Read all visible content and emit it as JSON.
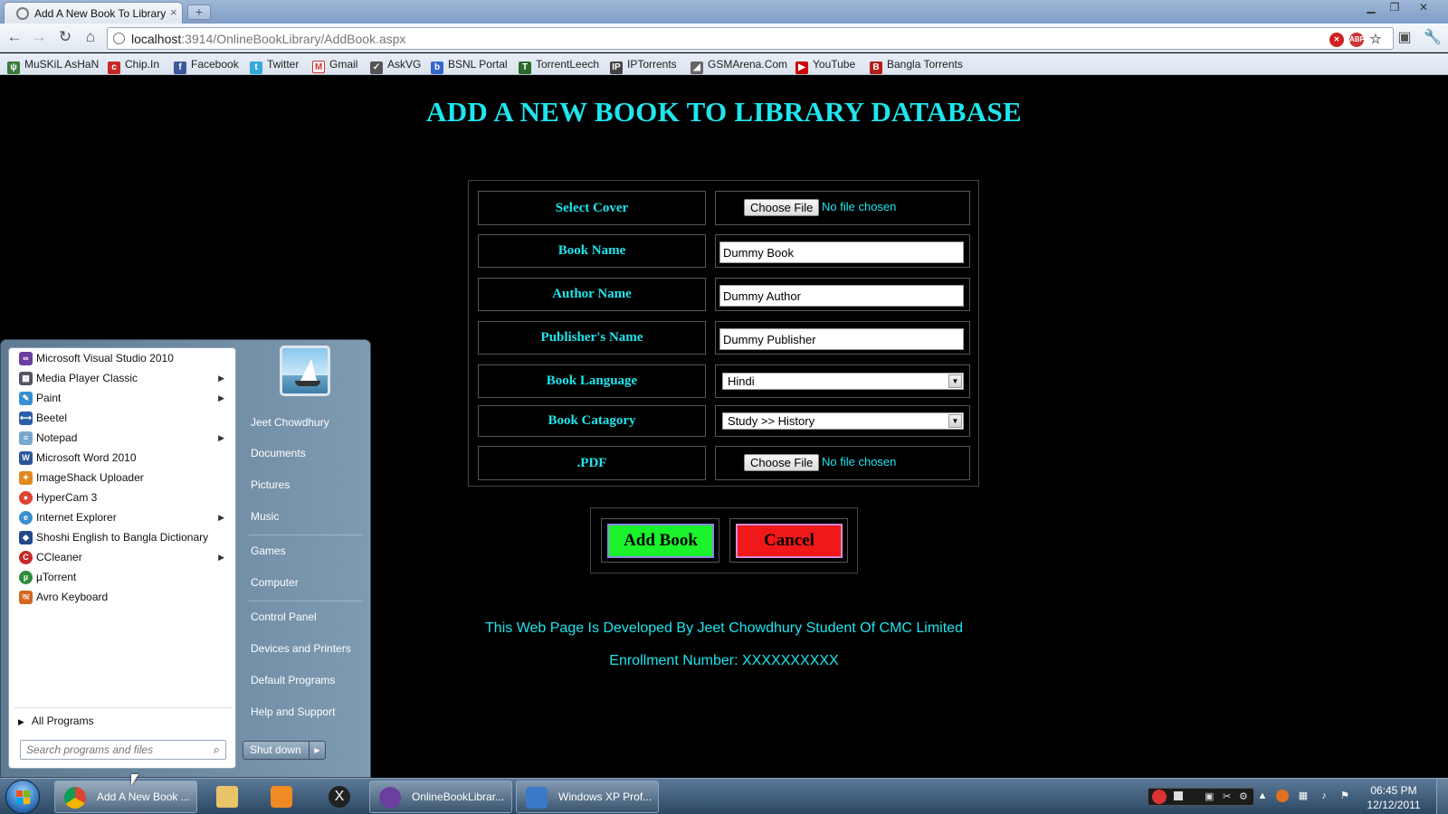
{
  "browser": {
    "tab_title": "Add A New Book To Library",
    "url_host": "localhost",
    "url_rest": ":3914/OnlineBookLibrary/AddBook.aspx",
    "bookmarks": [
      "MuSKiL AsHaN",
      "Chip.In",
      "Facebook",
      "Twitter",
      "Gmail",
      "AskVG",
      "BSNL Portal",
      "TorrentLeech",
      "IPTorrents",
      "GSMArena.Com",
      "YouTube",
      "Bangla Torrents"
    ]
  },
  "page": {
    "title": "ADD A NEW BOOK TO LIBRARY DATABASE",
    "form": {
      "cover_label": "Select Cover",
      "name_label": "Book Name",
      "name_value": "Dummy Book",
      "author_label": "Author Name",
      "author_value": "Dummy Author",
      "publisher_label": "Publisher's Name",
      "publisher_value": "Dummy Publisher",
      "language_label": "Book Language",
      "language_value": "Hindi",
      "category_label": "Book Catagory",
      "category_value": "Study >> History",
      "pdf_label": ".PDF",
      "choose_file": "Choose File",
      "no_file": "No file chosen"
    },
    "add_button": "Add Book",
    "cancel_button": "Cancel",
    "footer_line1": "This Web Page Is Developed By Jeet Chowdhury Student Of CMC Limited",
    "footer_line2": "Enrollment Number: XXXXXXXXXX"
  },
  "start_menu": {
    "programs": [
      {
        "label": "Microsoft Visual Studio 2010",
        "submenu": false
      },
      {
        "label": "Media Player Classic",
        "submenu": true
      },
      {
        "label": "Paint",
        "submenu": true
      },
      {
        "label": "Beetel",
        "submenu": false
      },
      {
        "label": "Notepad",
        "submenu": true
      },
      {
        "label": "Microsoft Word 2010",
        "submenu": false
      },
      {
        "label": "ImageShack Uploader",
        "submenu": false
      },
      {
        "label": "HyperCam 3",
        "submenu": false
      },
      {
        "label": "Internet Explorer",
        "submenu": true
      },
      {
        "label": "Shoshi English to Bangla Dictionary",
        "submenu": false
      },
      {
        "label": "CCleaner",
        "submenu": true
      },
      {
        "label": "µTorrent",
        "submenu": false
      },
      {
        "label": "Avro Keyboard",
        "submenu": false
      }
    ],
    "all_programs": "All Programs",
    "search_placeholder": "Search programs and files",
    "right_links": [
      "Jeet Chowdhury",
      "Documents",
      "Pictures",
      "Music",
      "Games",
      "Computer",
      "Control Panel",
      "Devices and Printers",
      "Default Programs",
      "Help and Support"
    ],
    "shutdown": "Shut down"
  },
  "taskbar": {
    "items": [
      "Add A New Book ...",
      "OnlineBookLibrar...",
      "Windows XP Prof..."
    ],
    "time": "06:45 PM",
    "date": "12/12/2011"
  }
}
